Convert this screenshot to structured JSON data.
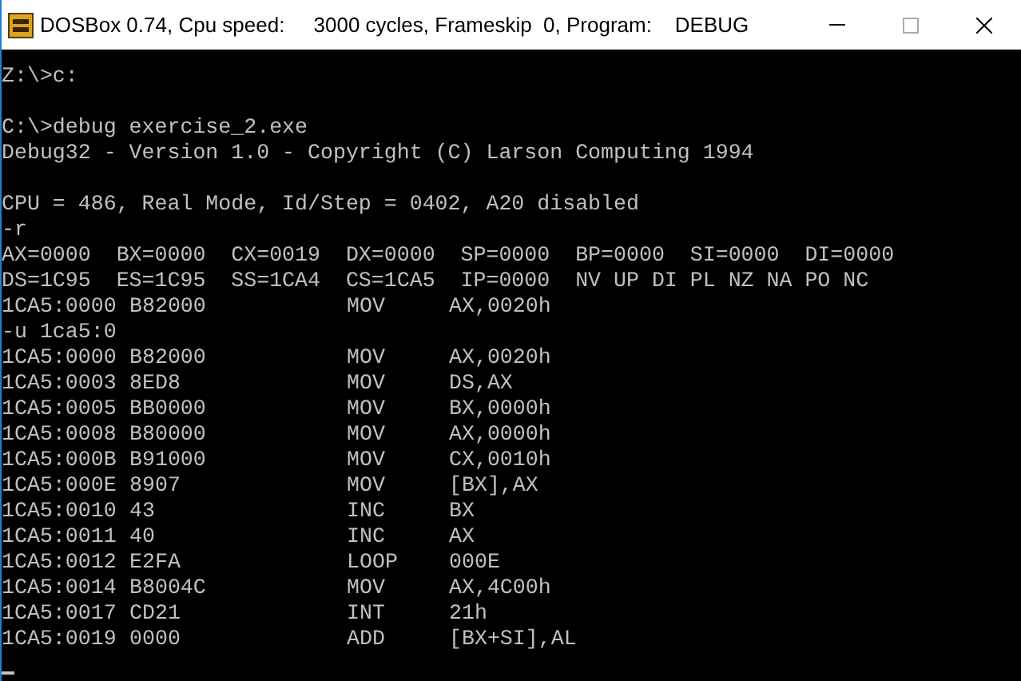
{
  "window": {
    "title": "DOSBox 0.74, Cpu speed:     3000 cycles, Frameskip  0, Program:    DEBUG"
  },
  "console": [
    {
      "kind": "text",
      "text": "Z:\\>c:"
    },
    {
      "kind": "blank"
    },
    {
      "kind": "text",
      "text": "C:\\>debug exercise_2.exe"
    },
    {
      "kind": "text",
      "text": "Debug32 - Version 1.0 - Copyright (C) Larson Computing 1994"
    },
    {
      "kind": "blank"
    },
    {
      "kind": "text",
      "text": "CPU = 486, Real Mode, Id/Step = 0402, A20 disabled"
    },
    {
      "kind": "text",
      "text": "-r"
    },
    {
      "kind": "text",
      "text": "AX=0000  BX=0000  CX=0019  DX=0000  SP=0000  BP=0000  SI=0000  DI=0000"
    },
    {
      "kind": "text",
      "text": "DS=1C95  ES=1C95  SS=1CA4  CS=1CA5  IP=0000  NV UP DI PL NZ NA PO NC"
    },
    {
      "kind": "disasm",
      "address": "1CA5:0000",
      "bytes": "B82000",
      "mnemonic": "MOV",
      "operand": "AX,0020h"
    },
    {
      "kind": "text",
      "text": "-u 1ca5:0"
    },
    {
      "kind": "disasm",
      "address": "1CA5:0000",
      "bytes": "B82000",
      "mnemonic": "MOV",
      "operand": "AX,0020h"
    },
    {
      "kind": "disasm",
      "address": "1CA5:0003",
      "bytes": "8ED8",
      "mnemonic": "MOV",
      "operand": "DS,AX"
    },
    {
      "kind": "disasm",
      "address": "1CA5:0005",
      "bytes": "BB0000",
      "mnemonic": "MOV",
      "operand": "BX,0000h"
    },
    {
      "kind": "disasm",
      "address": "1CA5:0008",
      "bytes": "B80000",
      "mnemonic": "MOV",
      "operand": "AX,0000h"
    },
    {
      "kind": "disasm",
      "address": "1CA5:000B",
      "bytes": "B91000",
      "mnemonic": "MOV",
      "operand": "CX,0010h"
    },
    {
      "kind": "disasm",
      "address": "1CA5:000E",
      "bytes": "8907",
      "mnemonic": "MOV",
      "operand": "[BX],AX"
    },
    {
      "kind": "disasm",
      "address": "1CA5:0010",
      "bytes": "43",
      "mnemonic": "INC",
      "operand": "BX"
    },
    {
      "kind": "disasm",
      "address": "1CA5:0011",
      "bytes": "40",
      "mnemonic": "INC",
      "operand": "AX"
    },
    {
      "kind": "disasm",
      "address": "1CA5:0012",
      "bytes": "E2FA",
      "mnemonic": "LOOP",
      "operand": "000E"
    },
    {
      "kind": "disasm",
      "address": "1CA5:0014",
      "bytes": "B8004C",
      "mnemonic": "MOV",
      "operand": "AX,4C00h"
    },
    {
      "kind": "disasm",
      "address": "1CA5:0017",
      "bytes": "CD21",
      "mnemonic": "INT",
      "operand": "21h"
    },
    {
      "kind": "disasm",
      "address": "1CA5:0019",
      "bytes": "0000",
      "mnemonic": "ADD",
      "operand": "[BX+SI],AL"
    },
    {
      "kind": "cursor"
    }
  ]
}
